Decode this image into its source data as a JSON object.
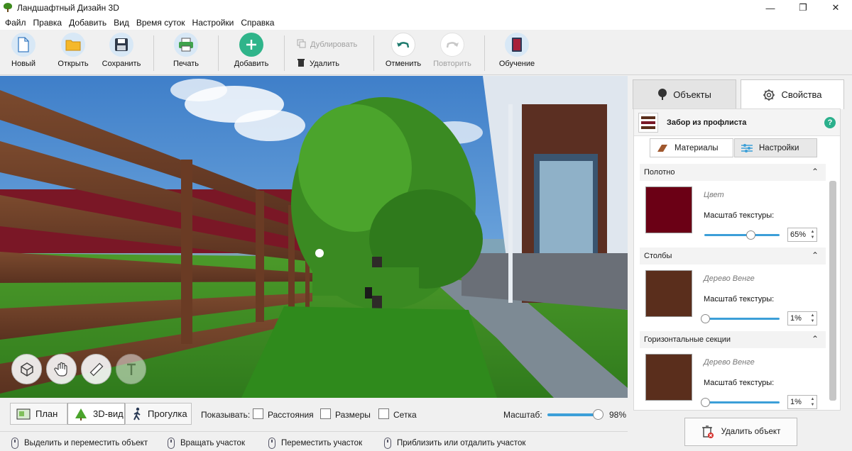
{
  "window": {
    "title": "Ландшафтный Дизайн 3D"
  },
  "menu": [
    "Файл",
    "Правка",
    "Добавить",
    "Вид",
    "Время суток",
    "Настройки",
    "Справка"
  ],
  "toolbar": {
    "new": "Новый",
    "open": "Открыть",
    "save": "Сохранить",
    "print": "Печать",
    "add": "Добавить",
    "duplicate": "Дублировать",
    "delete": "Удалить",
    "undo": "Отменить",
    "redo": "Повторить",
    "tutorial": "Обучение"
  },
  "panel": {
    "tabs": {
      "objects": "Объекты",
      "properties": "Свойства"
    },
    "object_name": "Забор из профлиста",
    "help": "?",
    "subtabs": {
      "materials": "Материалы",
      "settings": "Настройки"
    },
    "texture_scale_label": "Масштаб текстуры:",
    "sections": [
      {
        "title": "Полотно",
        "material": "Цвет",
        "color": "#6b0015",
        "scale": 0.65,
        "scale_text": "65%"
      },
      {
        "title": "Столбы",
        "material": "Дерево Венге",
        "color": "#5a2e1c",
        "scale": 0.01,
        "scale_text": "1%"
      },
      {
        "title": "Горизонтальные секции",
        "material": "Дерево Венге",
        "color": "#5a2e1c",
        "scale": 0.01,
        "scale_text": "1%"
      }
    ],
    "delete_object": "Удалить объект"
  },
  "viewbar": {
    "plan": "План",
    "view3d": "3D-вид",
    "walk": "Прогулка",
    "show_label": "Показывать:",
    "distances": "Расстояния",
    "sizes": "Размеры",
    "grid": "Сетка",
    "scale_label": "Масштаб:",
    "scale_value": "98%",
    "scale": 0.98
  },
  "status": {
    "select_move": "Выделить и переместить объект",
    "rotate": "Вращать участок",
    "move_plot": "Переместить участок",
    "zoom": "Приблизить или отдалить участок"
  },
  "colors": {
    "accent": "#3c9fd8",
    "add": "#2fb48a",
    "help": "#2bb08c"
  }
}
